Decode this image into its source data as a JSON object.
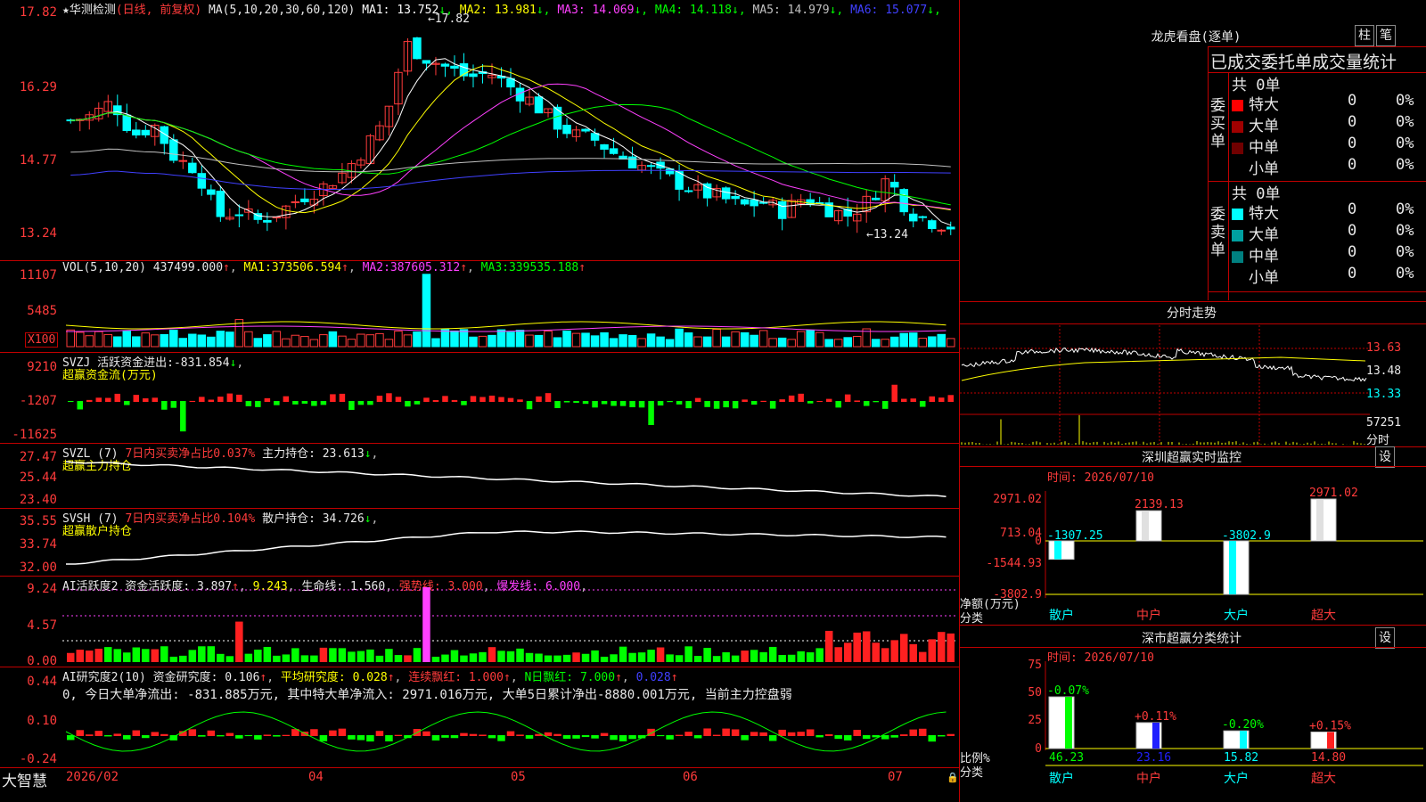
{
  "header": {
    "star": "★",
    "stock_name": "华测检测",
    "period": "(日线, 前复权)",
    "ma_params": "MA(5,10,20,30,60,120)",
    "ma": [
      {
        "label": "MA1:",
        "value": "13.752",
        "arrow": "↓",
        "color": "#ffffff"
      },
      {
        "label": "MA2:",
        "value": "13.981",
        "arrow": "↓",
        "color": "#ffff00"
      },
      {
        "label": "MA3:",
        "value": "14.069",
        "arrow": "↓",
        "color": "#ff40ff"
      },
      {
        "label": "MA4:",
        "value": "14.118",
        "arrow": "↓",
        "color": "#00ff00"
      },
      {
        "label": "MA5:",
        "value": "14.979",
        "arrow": "↓",
        "color": "#c0c0c0"
      },
      {
        "label": "MA6:",
        "value": "15.077",
        "arrow": "↓",
        "color": "#4040ff"
      }
    ]
  },
  "price_axis": [
    "17.82",
    "16.29",
    "14.77",
    "13.24"
  ],
  "price_high_mark": "←17.82",
  "price_low_mark": "←13.24",
  "vol_panel": {
    "label": "VOL(5,10,20)",
    "value": "437499.000",
    "arrow": "↑",
    "ma": [
      {
        "label": "MA1:",
        "value": "373506.594",
        "arrow": "↑"
      },
      {
        "label": "MA2:",
        "value": "387605.312",
        "arrow": "↑"
      },
      {
        "label": "MA3:",
        "value": "339535.188",
        "arrow": "↑"
      }
    ],
    "axis": [
      "11107",
      "5485"
    ],
    "unit": "X100"
  },
  "svzj_panel": {
    "label": "SVZJ",
    "name": "活跃资金进出:",
    "value": "-831.854",
    "arrow": "↓",
    "sub": "超赢资金流(万元)",
    "axis": [
      "9210",
      "-1207",
      "-11625"
    ]
  },
  "svzl_panel": {
    "label": "SVZL (7)",
    "pct": "7日内买卖净占比0.037%",
    "name": "主力持仓:",
    "value": "23.613",
    "arrow": "↓",
    "sub": "超赢主力持仓",
    "axis": [
      "27.47",
      "25.44",
      "23.40"
    ]
  },
  "svsh_panel": {
    "label": "SVSH (7)",
    "pct": "7日内买卖净占比0.104%",
    "name": "散户持仓:",
    "value": "34.726",
    "arrow": "↓",
    "sub": "超赢散户持仓",
    "axis": [
      "35.55",
      "33.74",
      "32.00"
    ]
  },
  "ai_active": {
    "label": "AI活跃度2",
    "name": "资金活跃度:",
    "value": "3.897",
    "arrow": "↑",
    "v2": "9.243",
    "life": "生命线:",
    "life_v": "1.560",
    "strong": "强势线:",
    "strong_v": "3.000",
    "burst": "爆发线:",
    "burst_v": "6.000",
    "axis": [
      "9.24",
      "4.57",
      "0.00"
    ]
  },
  "ai_research": {
    "label": "AI研究度2(10)",
    "name": "资金研究度:",
    "value": "0.106",
    "arrow": "↑",
    "avg": "平均研究度:",
    "avg_v": "0.028",
    "cont": "连续飘红:",
    "cont_v": "1.000",
    "n": "N日飘红:",
    "n_v": "7.000",
    "last": "0.028",
    "text": "0, 今日大单净流出: -831.885万元, 其中特大单净流入: 2971.016万元, 大单5日累计净出-8880.001万元, 当前主力控盘弱",
    "axis": [
      "0.44",
      "0.10",
      "-0.24"
    ]
  },
  "x_axis": {
    "brand": "大智慧",
    "ticks": [
      "2026/02",
      "04",
      "05",
      "06",
      "07"
    ]
  },
  "right": {
    "dragon_title": "龙虎看盘(逐单)",
    "btn_a": "柱",
    "btn_b": "笔",
    "stats_title": "已成交委托单成交量统计",
    "buy_side": "委买单",
    "sell_side": "委卖单",
    "buy_total": "共 0单",
    "sell_total": "共 0单",
    "buy_rows": [
      {
        "name": "特大",
        "v": "0",
        "p": "0%",
        "color": "#ff0000"
      },
      {
        "name": "大单",
        "v": "0",
        "p": "0%",
        "color": "#a00000"
      },
      {
        "name": "中单",
        "v": "0",
        "p": "0%",
        "color": "#700000"
      },
      {
        "name": "小单",
        "v": "0",
        "p": "0%",
        "color": "#000000"
      }
    ],
    "sell_rows": [
      {
        "name": "特大",
        "v": "0",
        "p": "0%",
        "color": "#00ffff"
      },
      {
        "name": "大单",
        "v": "0",
        "p": "0%",
        "color": "#00a0a0"
      },
      {
        "name": "中单",
        "v": "0",
        "p": "0%",
        "color": "#008080"
      },
      {
        "name": "小单",
        "v": "0",
        "p": "0%",
        "color": "#000000"
      }
    ],
    "intraday_title": "分时走势",
    "intraday_axis": [
      "13.63",
      "13.48",
      "13.33"
    ],
    "intraday_vol": "57251",
    "intraday_unit": "分时",
    "sz_monitor_title": "深圳超赢实时监控",
    "sz_time": "时间: 2026/07/10",
    "sz_axis": [
      "2971.02",
      "713.04",
      "0",
      "-1544.93",
      "-3802.9"
    ],
    "sz_unit": "净额(万元)",
    "sz_class": "分类",
    "set": "设",
    "sz_bars": [
      {
        "cat": "散户",
        "label": "-1307.25",
        "value": -1307.25,
        "color": "#00ffff"
      },
      {
        "cat": "中户",
        "label": "2139.13",
        "value": 2139.13,
        "color": "#e0e0e0"
      },
      {
        "cat": "大户",
        "label": "-3802.9",
        "value": -3802.9,
        "color": "#00ffff"
      },
      {
        "cat": "超大",
        "label": "2971.02",
        "value": 2971.02,
        "color": "#e0e0e0"
      }
    ],
    "sz_class_title": "深市超赢分类统计",
    "sz_class_time": "时间: 2026/07/10",
    "cls_axis": [
      "75",
      "50",
      "25",
      "0"
    ],
    "cls_unit": "比例%",
    "cls_class": "分类",
    "cls_bars": [
      {
        "cat": "散户",
        "pct": "-0.07%",
        "value": 46.23,
        "label": "46.23",
        "color": "#00ff00"
      },
      {
        "cat": "中户",
        "pct": "+0.11%",
        "value": 23.16,
        "label": "23.16",
        "color": "#2020ff"
      },
      {
        "cat": "大户",
        "pct": "-0.20%",
        "value": 15.82,
        "label": "15.82",
        "color": "#00ffff"
      },
      {
        "cat": "超大",
        "pct": "+0.15%",
        "value": 14.8,
        "label": "14.80",
        "color": "#ff2020"
      }
    ]
  }
}
